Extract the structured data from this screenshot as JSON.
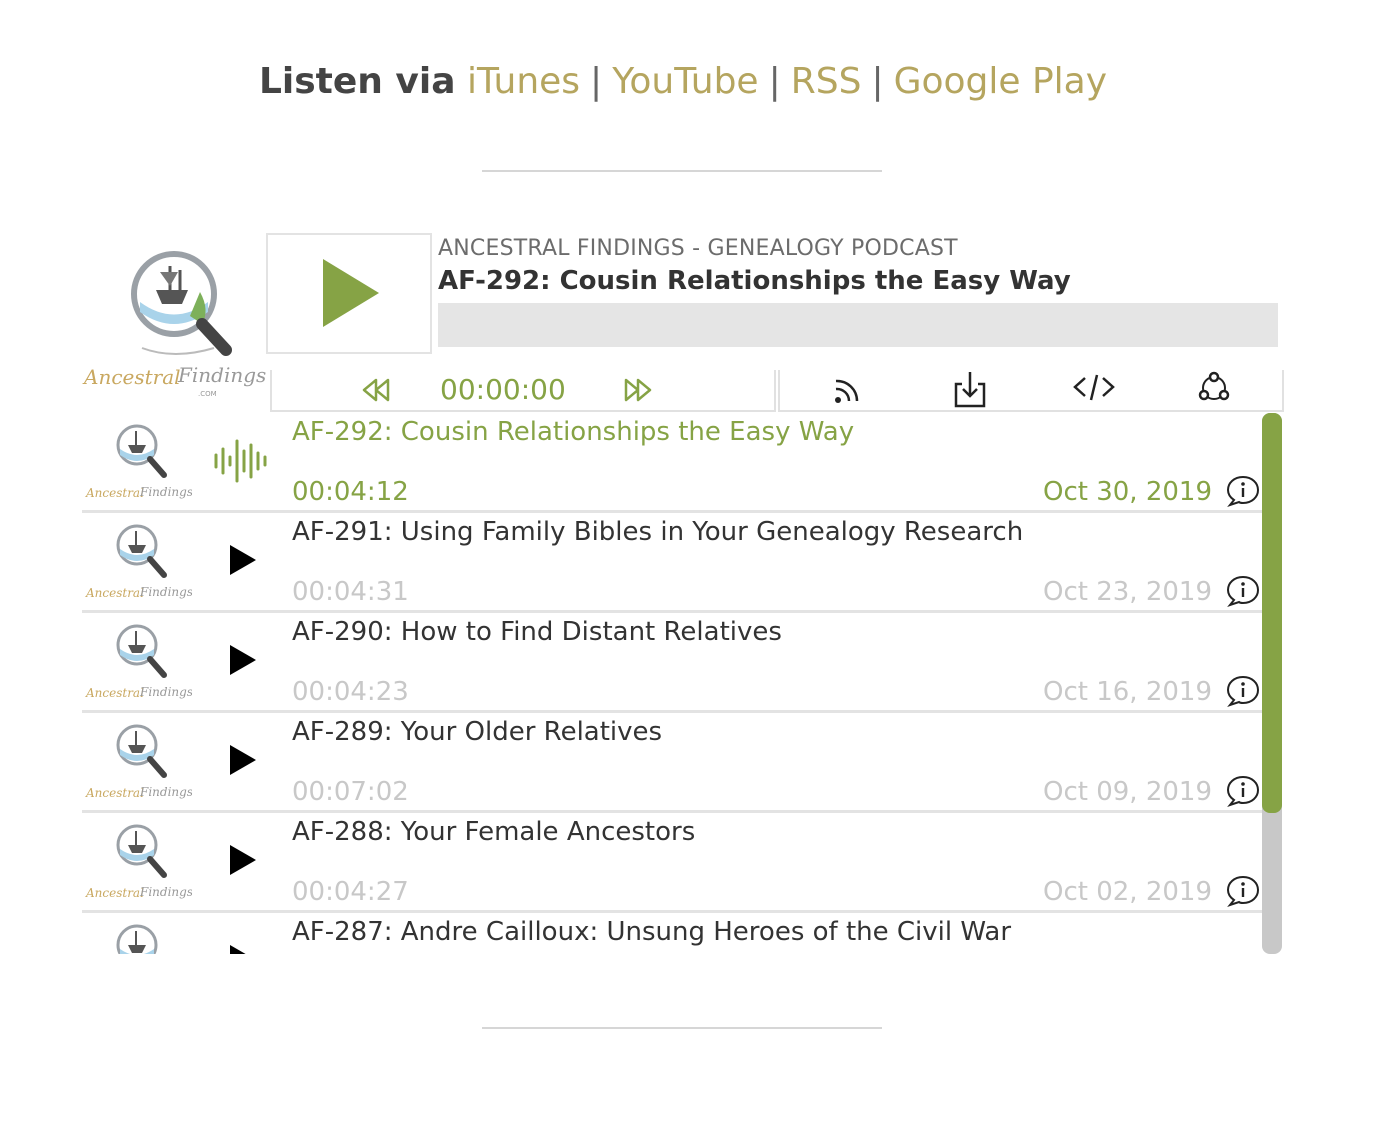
{
  "listen": {
    "label": "Listen via",
    "links": [
      "iTunes",
      "YouTube",
      "RSS",
      "Google Play"
    ],
    "separator": "|"
  },
  "podcast": {
    "name": "ANCESTRAL FINDINGS - GENEALOGY PODCAST",
    "current_title": "AF-292: Cousin Relationships the Easy Way",
    "current_time": "00:00:00",
    "progress": 0
  },
  "icons": {
    "rewind": "rewind-icon",
    "fast_forward": "fast-forward-icon",
    "subscribe": "rss-icon",
    "download": "download-icon",
    "embed": "embed-code-icon",
    "share": "share-icon"
  },
  "colors": {
    "accent": "#86a345",
    "link": "#b5a55f",
    "muted": "#c8c8c8"
  },
  "episodes": [
    {
      "title": "AF-292: Cousin Relationships the Easy Way",
      "duration": "00:04:12",
      "date": "Oct 30, 2019",
      "active": true
    },
    {
      "title": "AF-291: Using Family Bibles in Your Genealogy Research",
      "duration": "00:04:31",
      "date": "Oct 23, 2019",
      "active": false
    },
    {
      "title": "AF-290: How to Find Distant Relatives",
      "duration": "00:04:23",
      "date": "Oct 16, 2019",
      "active": false
    },
    {
      "title": "AF-289: Your Older Relatives",
      "duration": "00:07:02",
      "date": "Oct 09, 2019",
      "active": false
    },
    {
      "title": "AF-288: Your Female Ancestors",
      "duration": "00:04:27",
      "date": "Oct 02, 2019",
      "active": false
    },
    {
      "title": "AF-287: Andre Cailloux: Unsung Heroes of the Civil War",
      "duration": "",
      "date": "",
      "active": false
    }
  ]
}
